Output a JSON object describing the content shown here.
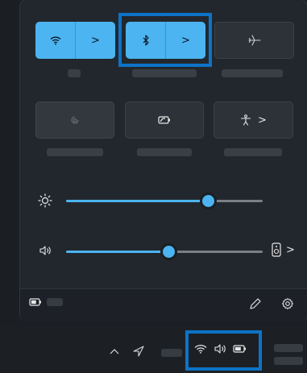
{
  "quick_settings": {
    "tiles_row1": [
      {
        "name": "wifi",
        "active": true,
        "has_arrow": true,
        "icon": "wifi-icon"
      },
      {
        "name": "bluetooth",
        "active": true,
        "has_arrow": true,
        "icon": "bluetooth-icon",
        "highlighted": true
      },
      {
        "name": "airplane-mode",
        "active": false,
        "has_arrow": false,
        "icon": "airplane-icon"
      }
    ],
    "tiles_row2": [
      {
        "name": "rotation-lock",
        "active": false,
        "disabled": true,
        "icon": "rotation-lock-icon"
      },
      {
        "name": "battery-saver",
        "active": false,
        "icon": "battery-saver-icon"
      },
      {
        "name": "accessibility",
        "active": false,
        "has_arrow": true,
        "icon": "accessibility-icon"
      }
    ],
    "arrow_glyph": ">",
    "brightness": {
      "icon": "brightness-icon",
      "level": 0.72
    },
    "volume": {
      "icon": "speaker-icon",
      "level": 0.52,
      "output_icon": "audio-output-icon",
      "arrow": ">"
    },
    "footer": {
      "battery_icon": "battery-icon",
      "edit_icon": "pencil-icon",
      "settings_icon": "gear-icon"
    }
  },
  "taskbar": {
    "overflow_icon": "chevron-up-icon",
    "location_icon": "location-arrow-icon",
    "system_tray": [
      "wifi-icon",
      "speaker-icon",
      "battery-icon"
    ],
    "tray_highlighted": true
  },
  "colors": {
    "accent": "#4cb4f0",
    "highlight": "#0d73c7",
    "panel": "#22272d"
  }
}
